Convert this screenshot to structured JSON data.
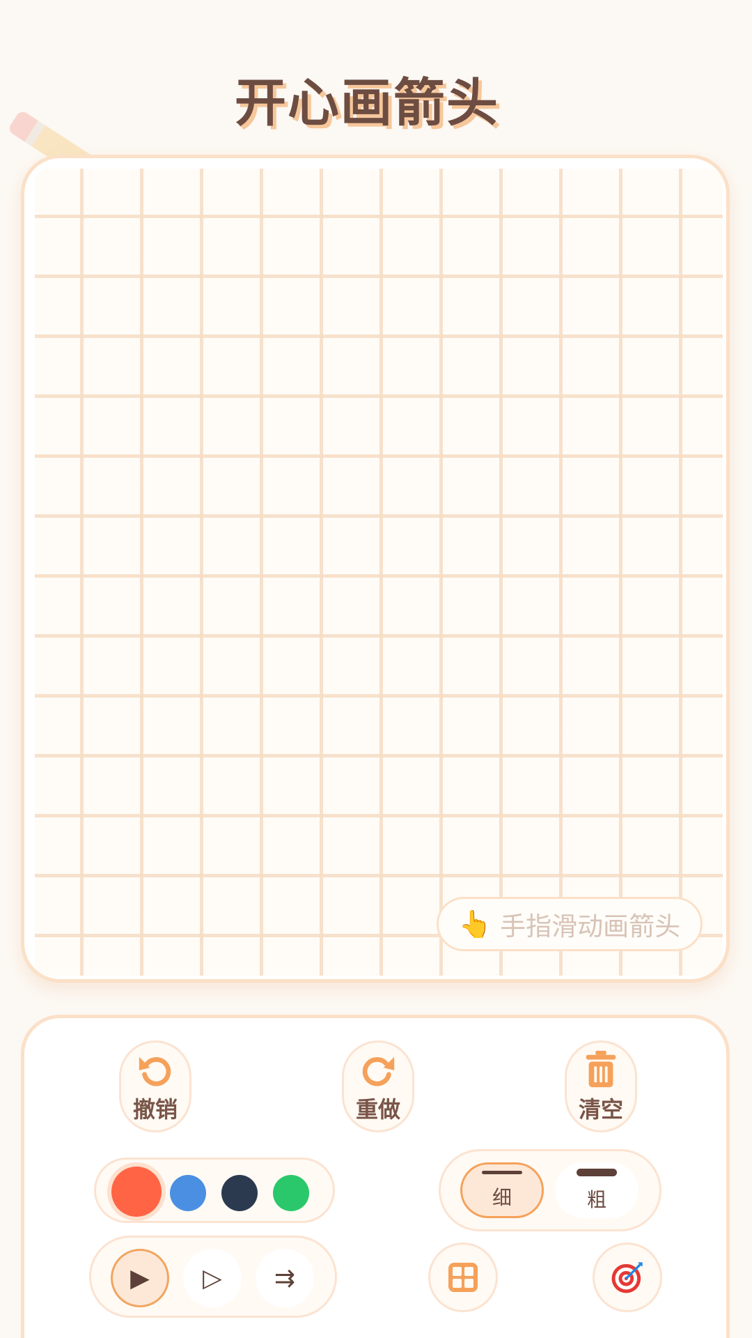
{
  "header": {
    "title": "开心画箭头"
  },
  "canvas": {
    "hint_icon": "👆",
    "hint_text": "手指滑动画箭头"
  },
  "toolbar": {
    "undo_label": "撤销",
    "redo_label": "重做",
    "clear_label": "清空",
    "colors": [
      {
        "name": "red",
        "hex": "#ff6445",
        "selected": true
      },
      {
        "name": "blue",
        "hex": "#4a8fe2",
        "selected": false
      },
      {
        "name": "navy",
        "hex": "#2c3a4f",
        "selected": false
      },
      {
        "name": "green",
        "hex": "#2ac86a",
        "selected": false
      }
    ],
    "thin_label": "细",
    "thick_label": "粗",
    "selected_thickness": "thin",
    "arrow_styles": [
      {
        "name": "filled",
        "glyph": "▶",
        "selected": true
      },
      {
        "name": "outline",
        "glyph": "▷",
        "selected": false
      },
      {
        "name": "double",
        "glyph": "⇉",
        "selected": false
      }
    ],
    "grid_toggle_icon": "grid-icon",
    "target_icon": "target-icon"
  },
  "theme": {
    "accent": "#f5a15a",
    "text": "#6d4c41",
    "border": "#fbe0c8",
    "background": "#fcf8f3"
  }
}
